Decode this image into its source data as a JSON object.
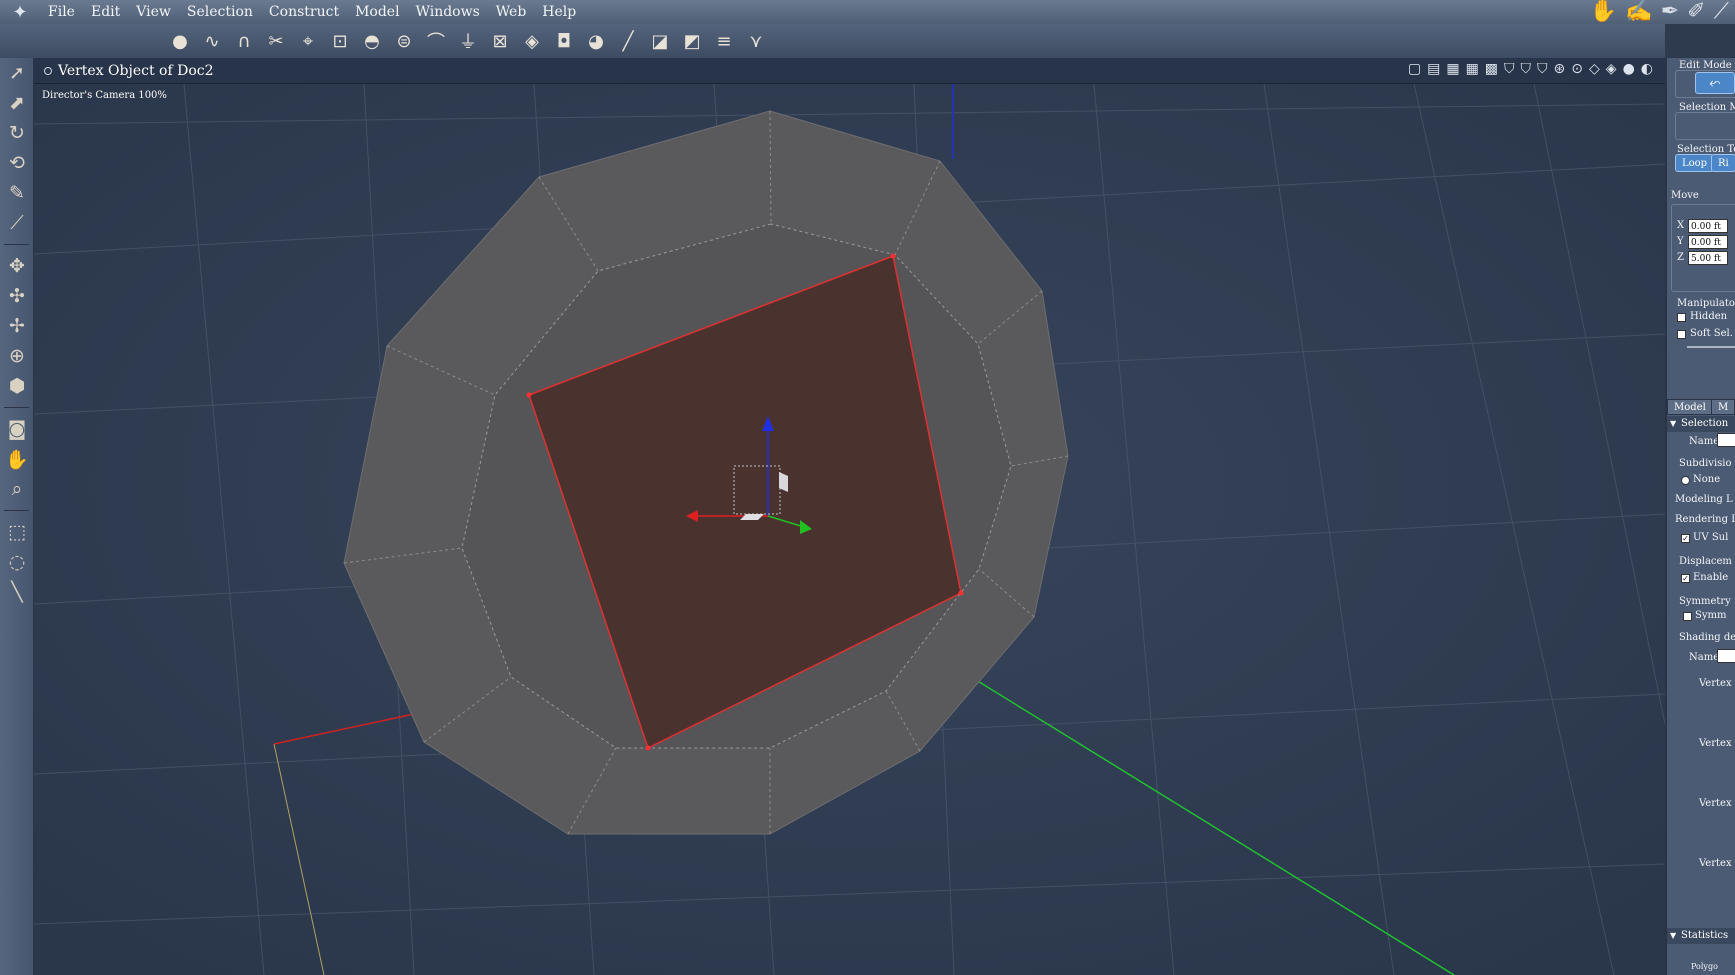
{
  "menubar": {
    "logo": "✦",
    "items": [
      "File",
      "Edit",
      "View",
      "Selection",
      "Construct",
      "Model",
      "Windows",
      "Web",
      "Help"
    ],
    "right_icons": [
      "hand-icon",
      "sketch-icon",
      "pen-icon",
      "brush-icon",
      "ruler-icon"
    ]
  },
  "toolbar": {
    "tools": [
      {
        "name": "sphere-tool-icon",
        "glyph": "●"
      },
      {
        "name": "spline-tool-icon",
        "glyph": "∿"
      },
      {
        "name": "magnet-tool-icon",
        "glyph": "∩"
      },
      {
        "name": "scissors-tool-icon",
        "glyph": "✂"
      },
      {
        "name": "vertex-tool-icon",
        "glyph": "⌖"
      },
      {
        "name": "scale-tool-icon",
        "glyph": "⊡"
      },
      {
        "name": "dome-tool-icon",
        "glyph": "◓"
      },
      {
        "name": "bevel-tool-icon",
        "glyph": "⊜"
      },
      {
        "name": "bend-tool-icon",
        "glyph": "⌒"
      },
      {
        "name": "lathe-tool-icon",
        "glyph": "⏚"
      },
      {
        "name": "box-tool-icon",
        "glyph": "⊠"
      },
      {
        "name": "cube-tool-icon",
        "glyph": "◈"
      },
      {
        "name": "shape-tool-icon",
        "glyph": "◘"
      },
      {
        "name": "blob-tool-icon",
        "glyph": "◕"
      },
      {
        "name": "line-tool-icon",
        "glyph": "╱"
      },
      {
        "name": "deform-tool-icon",
        "glyph": "◪"
      },
      {
        "name": "fold-tool-icon",
        "glyph": "◩"
      },
      {
        "name": "align-tool-icon",
        "glyph": "≡"
      },
      {
        "name": "tweak-tool-icon",
        "glyph": "⋎"
      }
    ]
  },
  "lefttools": [
    {
      "name": "select-arrow-icon",
      "glyph": "➚"
    },
    {
      "name": "select-object-icon",
      "glyph": "⬈"
    },
    {
      "name": "rotate-tool-icon",
      "glyph": "↻"
    },
    {
      "name": "twist-tool-icon",
      "glyph": "⟲"
    },
    {
      "name": "pencil-tool-icon",
      "glyph": "✎"
    },
    {
      "name": "knife-tool-icon",
      "glyph": "⟋"
    },
    {
      "name": "sep"
    },
    {
      "name": "move-tool-icon",
      "glyph": "✥"
    },
    {
      "name": "move-xz-icon",
      "glyph": "✣"
    },
    {
      "name": "move-xy-icon",
      "glyph": "✢"
    },
    {
      "name": "universal-manipulator-icon",
      "glyph": "⊕"
    },
    {
      "name": "extrude-icon",
      "glyph": "⬢"
    },
    {
      "name": "sep"
    },
    {
      "name": "camera-icon",
      "glyph": "◙"
    },
    {
      "name": "hand-pan-icon",
      "glyph": "✋"
    },
    {
      "name": "zoom-icon",
      "glyph": "⌕"
    },
    {
      "name": "sep"
    },
    {
      "name": "rect-select-icon",
      "glyph": "⬚"
    },
    {
      "name": "lasso-select-icon",
      "glyph": "◌"
    },
    {
      "name": "paint-select-icon",
      "glyph": "╲"
    }
  ],
  "viewport": {
    "title": "Vertex Object of Doc2",
    "camera_label": "Director's Camera 100%",
    "header_icons": [
      "▢",
      "▤",
      "▦",
      "▦",
      "▩",
      "⛉",
      "⛉",
      "⛉",
      "⊛",
      "⊙",
      "◇",
      "◈",
      "●",
      "◐"
    ]
  },
  "rightpanel": {
    "edit_mode": "Edit Mode",
    "selection_mode": "Selection M",
    "selection_tools": "Selection To",
    "loop_btn": "Loop",
    "ring_btn": "Ri",
    "move": "Move",
    "x_label": "X",
    "x_value": "0.00 ft",
    "y_label": "Y",
    "y_value": "0.00 ft",
    "z_label": "Z",
    "z_value": "5.00 ft",
    "manipulator": "Manipulato",
    "hidden": "Hidden",
    "soft_sel": "Soft Sel.",
    "tab_model": "Model",
    "tab_m": "M",
    "selection_section": "Selection",
    "name_label": "Name",
    "subdivision": "Subdivisio",
    "none": "None",
    "modeling": "Modeling L",
    "rendering": "Rendering L",
    "uv_sub": "UV Sul",
    "displacement": "Displacem",
    "enable": "Enable",
    "symmetry": "Symmetry",
    "symm": "Symm",
    "shading": "Shading de",
    "shading_name": "Name",
    "vertex_labels": [
      "Vertex",
      "Vertex",
      "Vertex",
      "Vertex"
    ],
    "statistics": "Statistics",
    "polygons": "Polygo"
  }
}
